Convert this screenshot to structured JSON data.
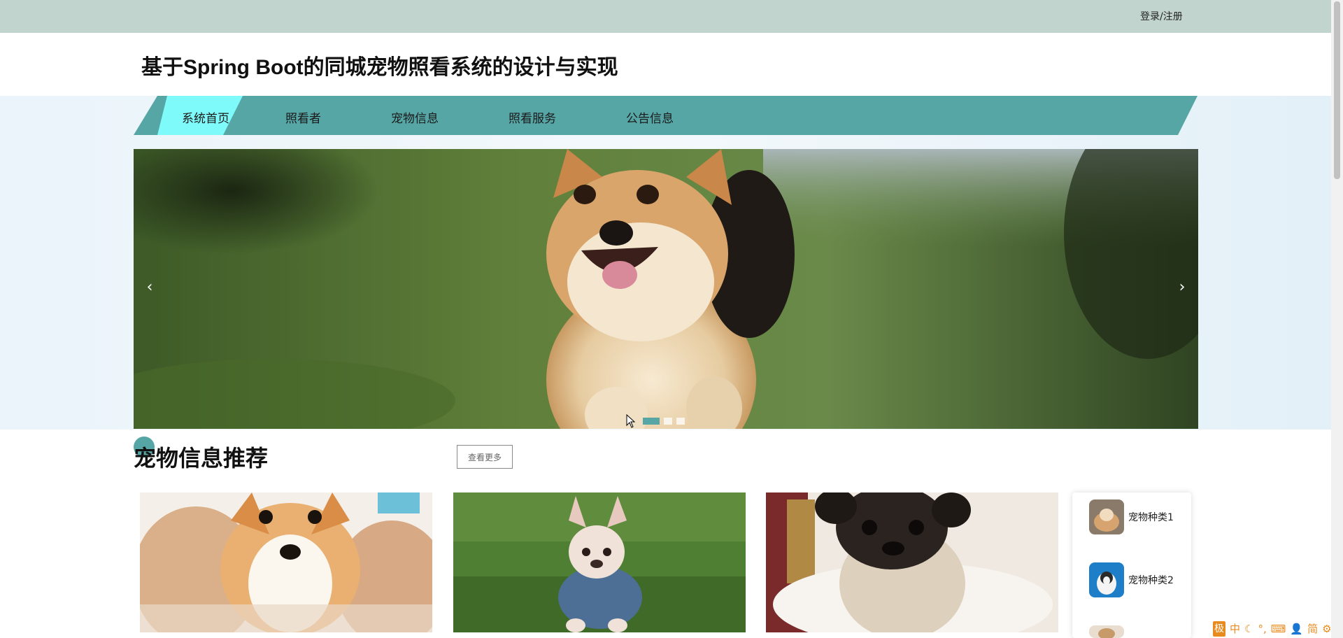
{
  "topbar": {
    "login_label": "登录/注册"
  },
  "header": {
    "title": "基于Spring Boot的同城宠物照看系统的设计与实现"
  },
  "nav": {
    "items": [
      {
        "label": "系统首页",
        "active": true
      },
      {
        "label": "照看者",
        "active": false
      },
      {
        "label": "宠物信息",
        "active": false
      },
      {
        "label": "照看服务",
        "active": false
      },
      {
        "label": "公告信息",
        "active": false
      }
    ]
  },
  "slider": {
    "prev_icon": "‹",
    "next_icon": "›",
    "dot_count": 3,
    "active_dot": 0
  },
  "section": {
    "title": "宠物信息推荐",
    "more_label": "查看更多"
  },
  "cards": [
    {
      "image": "corgi-puppy-photo"
    },
    {
      "image": "french-bulldog-photo"
    },
    {
      "image": "pug-puppy-photo"
    }
  ],
  "categories": [
    {
      "label": "宠物种类1"
    },
    {
      "label": "宠物种类2"
    }
  ],
  "ime": {
    "logo": "极",
    "lang": "中",
    "mode": "简"
  },
  "colors": {
    "topbar": "#c2d4ce",
    "nav": "#57a6a6",
    "nav_active": "#7ffafa",
    "accent": "#57a6a6"
  }
}
